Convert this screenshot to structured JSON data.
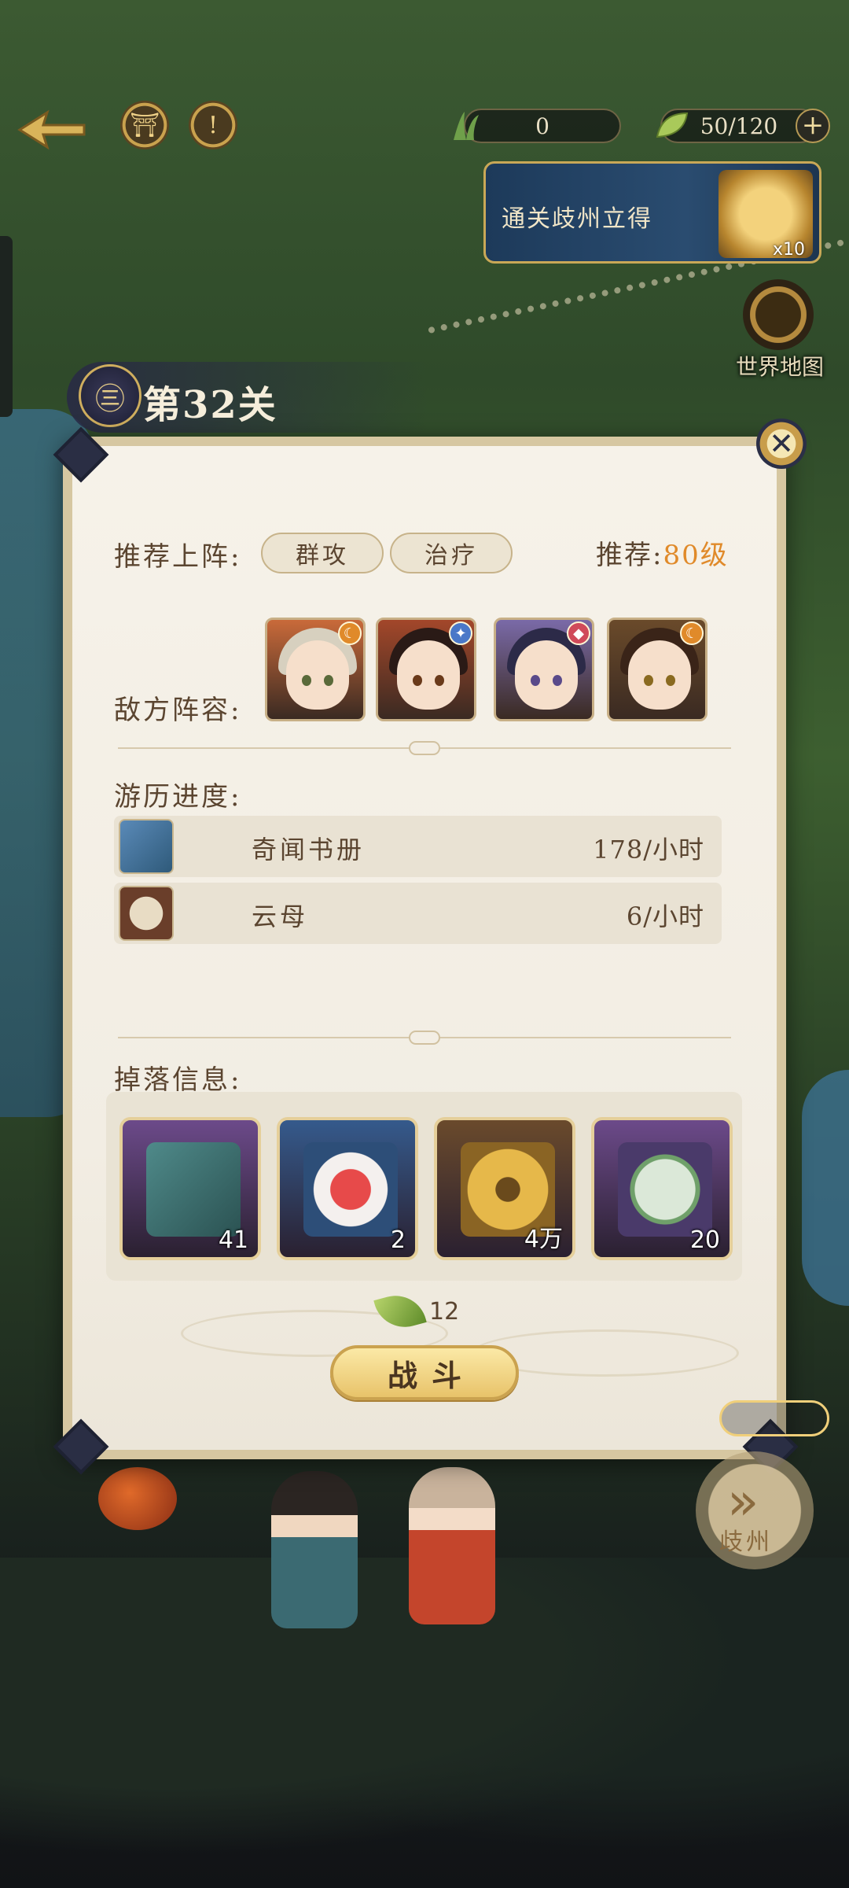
{
  "hud": {
    "resource_a_value": "0",
    "stamina_value": "50/120",
    "plus_label": "+",
    "back_icon": "back-arrow-icon",
    "shop_icon": "pavilion-icon",
    "alert_icon": "exclamation-icon",
    "alert_label": "!"
  },
  "quest": {
    "text": "通关歧州立得",
    "reward_count": "x10"
  },
  "world_map": {
    "label": "世界地图"
  },
  "stage": {
    "title": "第32关",
    "emblem_char": "㊂"
  },
  "panel": {
    "close_label": "✕",
    "recommend_label": "推荐上阵:",
    "tags": [
      "群攻",
      "治疗"
    ],
    "level_prefix": "推荐:",
    "level_value": "80级",
    "enemy_label": "敌方阵容:",
    "enemies": [
      {
        "hair_color": "#d7d0bf",
        "eye_color": "#5a6a3a",
        "badge_color": "#e08a2a",
        "badge_icon": "moon-icon",
        "bg": "#c96a3a"
      },
      {
        "hair_color": "#2a1a16",
        "eye_color": "#6a3a1a",
        "badge_color": "#4a78c8",
        "badge_icon": "star-icon",
        "bg": "#a3472a"
      },
      {
        "hair_color": "#2c2a48",
        "eye_color": "#5a4a8a",
        "badge_color": "#d04a5a",
        "badge_icon": "diamond-icon",
        "bg": "#7a6aa8"
      },
      {
        "hair_color": "#3a2418",
        "eye_color": "#8a6a20",
        "badge_color": "#e08a2a",
        "badge_icon": "moon-icon",
        "bg": "#6a4a2a"
      }
    ],
    "progress_label": "游历进度:",
    "progress_items": [
      {
        "name": "奇闻书册",
        "rate": "178/小时",
        "icon": "book-icon"
      },
      {
        "name": "云母",
        "rate": "6/小时",
        "icon": "mica-icon"
      }
    ],
    "drop_label": "掉落信息:",
    "drops": [
      {
        "qty": "41",
        "icon": "book-with-flowers-icon",
        "frame": "#6c4a8a"
      },
      {
        "qty": "2",
        "icon": "bowl-icon",
        "frame": "#355a8c"
      },
      {
        "qty": "4万",
        "icon": "coin-icon",
        "frame": "#6a4a2c"
      },
      {
        "qty": "20",
        "icon": "jade-fan-icon",
        "frame": "#6c4a8a"
      }
    ],
    "cost_value": "12",
    "battle_label": "战斗"
  },
  "next_region": {
    "label": "歧州"
  },
  "colors": {
    "accent_orange": "#e08a2a",
    "panel_bg": "#f4efe5",
    "text_brown": "#5b4530",
    "gold": "#e8c36a"
  }
}
